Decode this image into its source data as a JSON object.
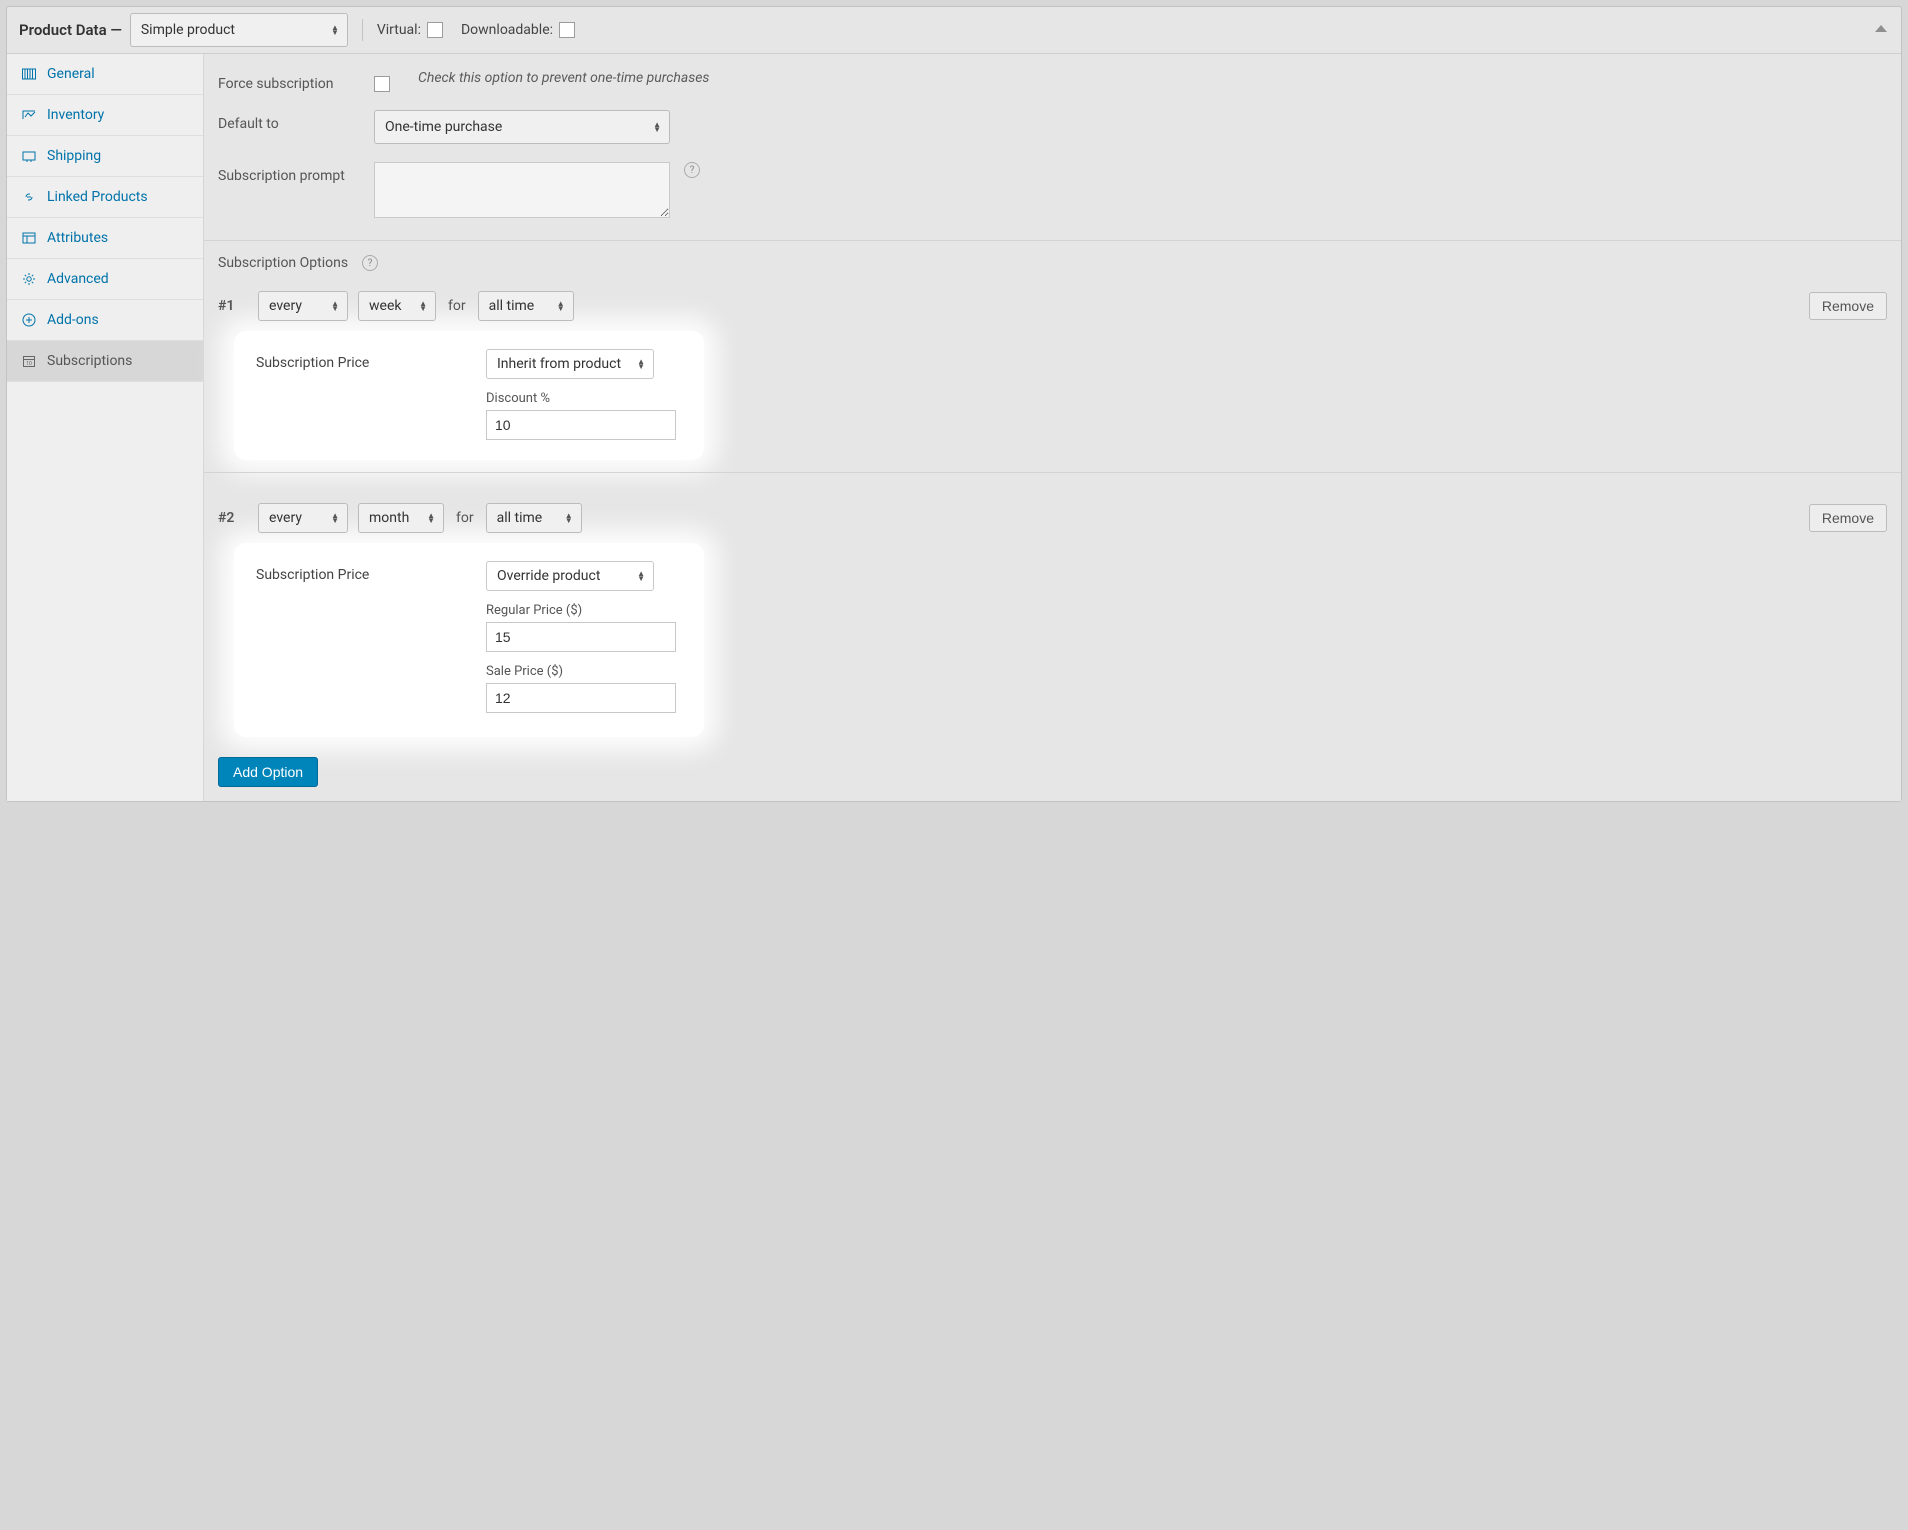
{
  "header": {
    "title": "Product Data —",
    "product_type": "Simple product",
    "virtual_label": "Virtual:",
    "downloadable_label": "Downloadable:"
  },
  "sidebar": {
    "items": [
      {
        "label": "General"
      },
      {
        "label": "Inventory"
      },
      {
        "label": "Shipping"
      },
      {
        "label": "Linked Products"
      },
      {
        "label": "Attributes"
      },
      {
        "label": "Advanced"
      },
      {
        "label": "Add-ons"
      },
      {
        "label": "Subscriptions"
      }
    ]
  },
  "form": {
    "force_sub_label": "Force subscription",
    "force_sub_hint": "Check this option to prevent one-time purchases",
    "default_to_label": "Default to",
    "default_to_value": "One-time purchase",
    "sub_prompt_label": "Subscription prompt"
  },
  "sub_options": {
    "heading": "Subscription Options",
    "for_text": "for",
    "remove_label": "Remove",
    "add_label": "Add Option",
    "price_label": "Subscription Price",
    "discount_label": "Discount %",
    "regular_price_label": "Regular Price ($)",
    "sale_price_label": "Sale Price ($)",
    "options": [
      {
        "index": "#1",
        "freq": "every",
        "unit": "week",
        "duration": "all time",
        "price_mode": "Inherit from product",
        "discount": "10"
      },
      {
        "index": "#2",
        "freq": "every",
        "unit": "month",
        "duration": "all time",
        "price_mode": "Override product",
        "regular_price": "15",
        "sale_price": "12"
      }
    ]
  }
}
